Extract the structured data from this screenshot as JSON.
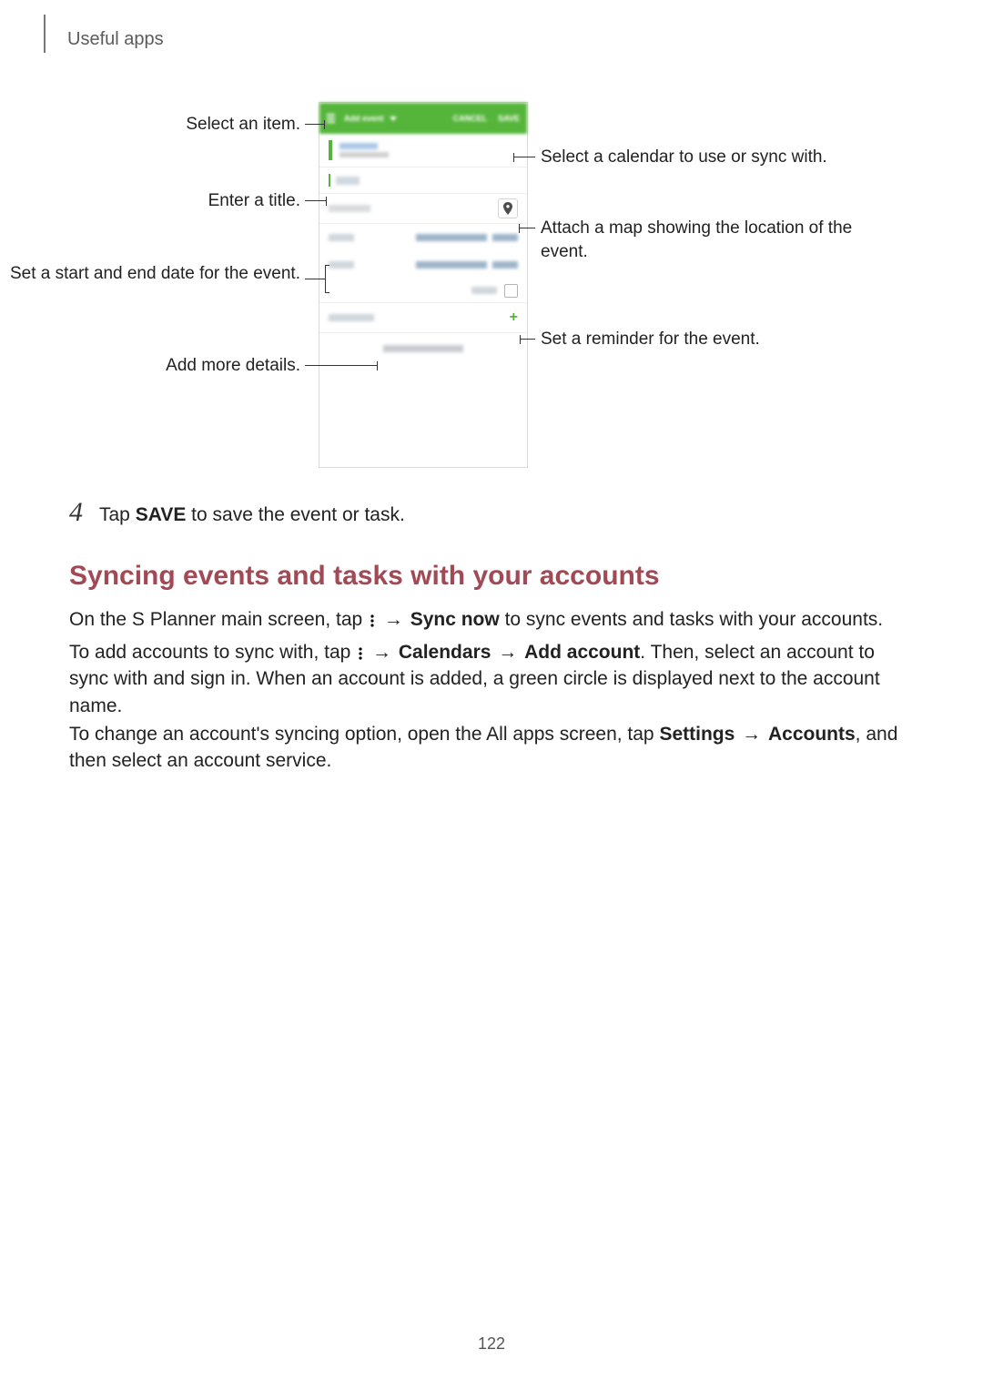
{
  "header": "Useful apps",
  "figure_callouts": {
    "select_item": "Select an item.",
    "enter_title": "Enter a title.",
    "set_dates": "Set a start and end date for the event.",
    "add_details": "Add more details.",
    "select_calendar": "Select a calendar to use or sync with.",
    "attach_map": "Attach a map showing the location of the event.",
    "set_reminder": "Set a reminder for the event."
  },
  "step": {
    "num": "4",
    "pre": "Tap ",
    "bold": "SAVE",
    "post": " to save the event or task."
  },
  "heading": "Syncing events and tasks with your accounts",
  "p1": {
    "a": "On the S Planner main screen, tap ",
    "b": "Sync now",
    "c": " to sync events and tasks with your accounts."
  },
  "p2": {
    "a": "To add accounts to sync with, tap ",
    "b": "Calendars",
    "c": "Add account",
    "d": ". Then, select an account to sync with and sign in. When an account is added, a green circle is displayed next to the account name."
  },
  "p3": {
    "a": "To change an account's syncing option, open the All apps screen, tap ",
    "b": "Settings",
    "c": "Accounts",
    "d": ", and then select an account service."
  },
  "arrow": "→",
  "page_number": "122"
}
